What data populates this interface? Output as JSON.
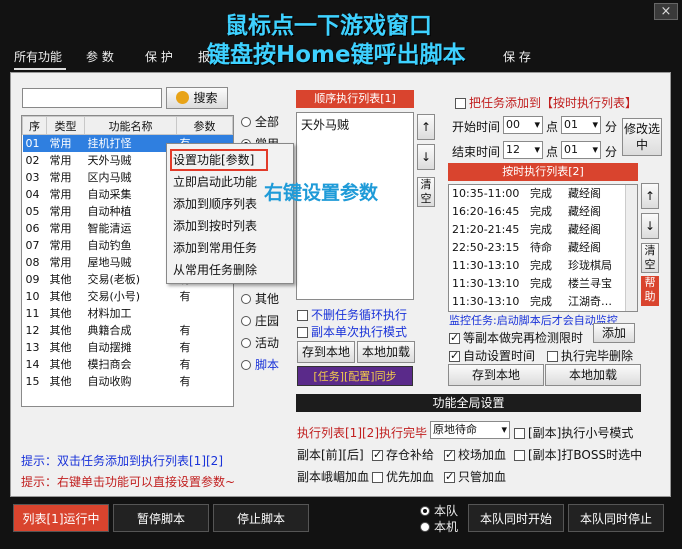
{
  "window": {
    "close_label": "×"
  },
  "overlay": {
    "line1": "鼠标点一下游戏窗口",
    "line2": "键盘按Home键呼出脚本"
  },
  "tabs": [
    {
      "label": "所有功能"
    },
    {
      "label": "参 数"
    },
    {
      "label": "保 护"
    },
    {
      "label": "报"
    },
    {
      "label": "保 存"
    }
  ],
  "search": {
    "value": "",
    "button_label": "搜索"
  },
  "task_table": {
    "columns": [
      "序",
      "类型",
      "功能名称",
      "参数"
    ],
    "rows": [
      [
        "01",
        "常用",
        "挂机打怪",
        "有"
      ],
      [
        "02",
        "常用",
        "天外马贼",
        ""
      ],
      [
        "03",
        "常用",
        "区内马贼",
        ""
      ],
      [
        "04",
        "常用",
        "自动采集",
        ""
      ],
      [
        "05",
        "常用",
        "自动种植",
        ""
      ],
      [
        "06",
        "常用",
        "智能清运",
        ""
      ],
      [
        "07",
        "常用",
        "自动钓鱼",
        ""
      ],
      [
        "08",
        "常用",
        "屋地马贼",
        ""
      ],
      [
        "09",
        "其他",
        "交易(老板)",
        "有"
      ],
      [
        "10",
        "其他",
        "交易(小号)",
        "有"
      ],
      [
        "11",
        "其他",
        "材料加工",
        ""
      ],
      [
        "12",
        "其他",
        "典籍合成",
        "有"
      ],
      [
        "13",
        "其他",
        "自动摆摊",
        "有"
      ],
      [
        "14",
        "其他",
        "模扫商会",
        "有"
      ],
      [
        "15",
        "其他",
        "自动收购",
        "有"
      ]
    ]
  },
  "filters": [
    "全部",
    "常用",
    "其他",
    "庄园",
    "活动",
    "脚本"
  ],
  "context_menu": {
    "items": [
      "设置功能[参数]",
      "立即启动此功能",
      "添加到顺序列表",
      "添加到按时列表",
      "添加到常用任务",
      "从常用任务删除"
    ],
    "annotation": "右键设置参数"
  },
  "sequence": {
    "header": "顺序执行列表[1]",
    "items": [
      "天外马贼"
    ],
    "up": "↑",
    "down": "↓",
    "clear": "清空",
    "opt_no_delete": "不删任务循环执行",
    "opt_single": "副本单次执行模式",
    "save_local": "存到本地",
    "load_local": "本地加载",
    "sync_button": "[任务][配置]同步"
  },
  "timed": {
    "add_label": "把任务添加到【按时执行列表】",
    "start_label": "开始时间",
    "start_hour": "00",
    "start_min": "01",
    "end_label": "结束时间",
    "end_hour": "12",
    "end_min": "01",
    "point": "点",
    "minute": "分",
    "modify_button": "修改选中",
    "header": "按时执行列表[2]",
    "rows": [
      [
        "10:35-11:00",
        "完成",
        "藏经阁"
      ],
      [
        "16:20-16:45",
        "完成",
        "藏经阁"
      ],
      [
        "21:20-21:45",
        "完成",
        "藏经阁"
      ],
      [
        "22:50-23:15",
        "待命",
        "藏经阁"
      ],
      [
        "11:30-13:10",
        "完成",
        "珍珑棋局"
      ],
      [
        "11:30-13:10",
        "完成",
        "楼兰寻宝"
      ],
      [
        "11:30-13:10",
        "完成",
        "江湖奇…"
      ]
    ],
    "up": "↑",
    "down": "↓",
    "clear": "清空",
    "help": "帮助",
    "monitor_text": "监控任务:启动脚本后才会自动监控",
    "opt_wait_copy": "等副本做完再检测限时",
    "add_button": "添加",
    "opt_auto_time": "自动设置时间",
    "opt_delete_done": "执行完毕删除",
    "save_local": "存到本地",
    "load_local": "本地加载"
  },
  "global": {
    "header": "功能全局设置",
    "exec_label": "执行列表[1][2]执行完毕",
    "exec_value": "原地待命",
    "opt_copy_small": "[副本]执行小号模式",
    "copy_front": "副本[前][后]",
    "opt_storage": "存仓补给",
    "opt_school_add": "校场加血",
    "opt_boss": "[副本]打BOSS时选中",
    "copy_cliff": "副本峨嵋加血",
    "opt_priority_add": "优先加血",
    "opt_only_add": "只管加血"
  },
  "tips": {
    "tip1": "提示：双击任务添加到执行列表[1][2]",
    "tip2": "提示：右键单击功能可以直接设置参数~"
  },
  "bottom": {
    "run_label": "列表[1]运行中",
    "pause_label": "暂停脚本",
    "stop_label": "停止脚本",
    "team_label": "本队",
    "machine_label": "本机",
    "team_start": "本队同时开始",
    "team_stop": "本队同时停止"
  },
  "colors": {
    "accent_red": "#d9442e",
    "selection_blue": "#2f7fe0",
    "overlay_cyan": "#3ed1ff",
    "sync_purple": "#5a2a8a"
  }
}
